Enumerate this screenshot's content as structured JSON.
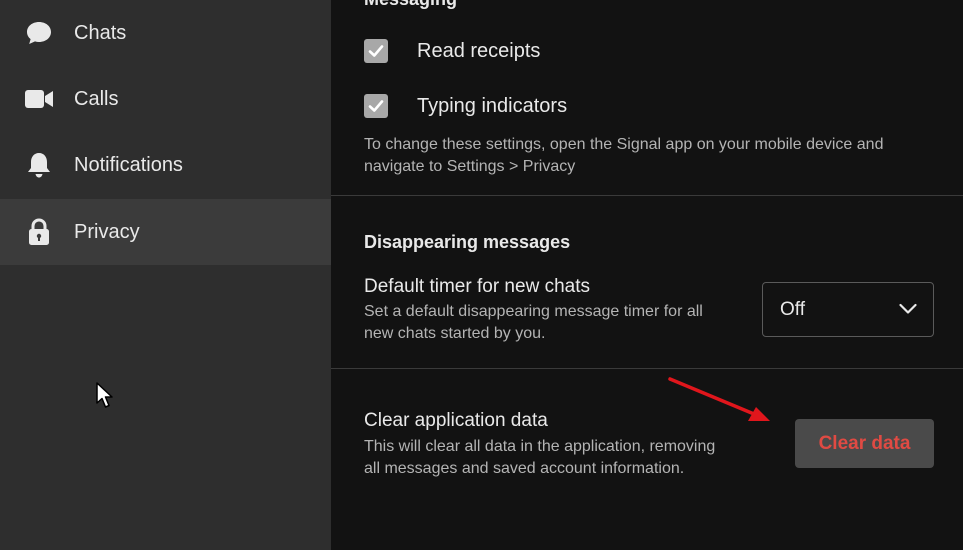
{
  "sidebar": {
    "items": [
      {
        "label": "Chats",
        "icon": "chat-bubble-icon"
      },
      {
        "label": "Calls",
        "icon": "video-camera-icon"
      },
      {
        "label": "Notifications",
        "icon": "bell-icon"
      },
      {
        "label": "Privacy",
        "icon": "lock-icon",
        "active": true
      }
    ]
  },
  "main": {
    "messaging": {
      "title": "Messaging",
      "read_receipts": {
        "label": "Read receipts",
        "checked": true
      },
      "typing_indicators": {
        "label": "Typing indicators",
        "checked": true
      },
      "note": "To change these settings, open the Signal app on your mobile device and navigate to Settings > Privacy"
    },
    "disappearing": {
      "title": "Disappearing messages",
      "default_timer": {
        "title": "Default timer for new chats",
        "description": "Set a default disappearing message timer for all new chats started by you.",
        "value": "Off"
      }
    },
    "clear_data": {
      "title": "Clear application data",
      "description": "This will clear all data in the application, removing all messages and saved account information.",
      "button_label": "Clear data"
    }
  },
  "colors": {
    "sidebar_bg": "#2e2e2e",
    "active_item_bg": "#3b3b3b",
    "main_bg": "#121212",
    "danger_text": "#e04a43",
    "annotation_arrow": "#e0161c"
  }
}
